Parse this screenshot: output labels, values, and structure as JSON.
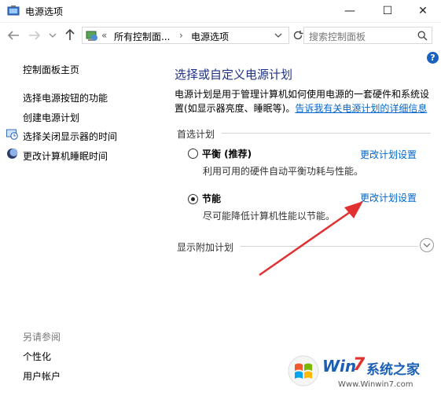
{
  "window": {
    "title": "电源选项",
    "minimize_glyph": "—",
    "maximize_glyph": "☐",
    "close_glyph": "✕"
  },
  "nav": {
    "back_icon": "arrow-left-icon",
    "forward_icon": "arrow-right-icon",
    "up_icon": "arrow-up-icon"
  },
  "address": {
    "prefix": "«",
    "crumbs": [
      "所有控制面...",
      "电源选项"
    ],
    "separator": "›"
  },
  "search": {
    "placeholder": "搜索控制面板"
  },
  "sidebar": {
    "home": "控制面板主页",
    "items": [
      {
        "label": "选择电源按钮的功能",
        "icon": ""
      },
      {
        "label": "创建电源计划",
        "icon": ""
      },
      {
        "label": "选择关闭显示器的时间",
        "icon": "clock-icon"
      },
      {
        "label": "更改计算机睡眠时间",
        "icon": "moon-icon"
      }
    ],
    "see_also": "另请参阅",
    "see_also_items": [
      "个性化",
      "用户帐户"
    ]
  },
  "main": {
    "heading": "选择或自定义电源计划",
    "description": "电源计划是用于管理计算机如何使用电源的一套硬件和系统设置(如显示器亮度、睡眠等)。",
    "description_link": "告诉我有关电源计划的详细信息",
    "preferred_label": "首选计划",
    "plans": [
      {
        "name": "平衡 (推荐)",
        "desc": "利用可用的硬件自动平衡功耗与性能。",
        "selected": false,
        "link": "更改计划设置"
      },
      {
        "name": "节能",
        "desc": "尽可能降低计算机性能以节能。",
        "selected": true,
        "link": "更改计划设置"
      }
    ],
    "additional_label": "显示附加计划"
  },
  "watermark": {
    "brand_a": "Win",
    "brand_b": "7",
    "brand_c": "系统之家",
    "url": "Www.Winwin7.com"
  },
  "colors": {
    "heading": "#1e3287",
    "link": "#0066cc",
    "arrow": "#e03030"
  }
}
